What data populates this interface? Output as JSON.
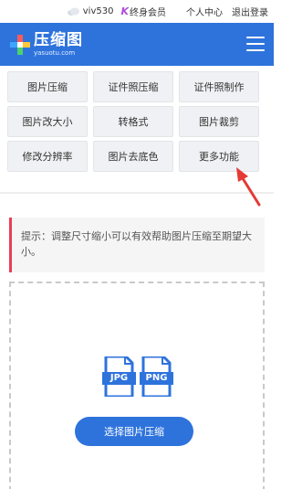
{
  "topbar": {
    "username": "viv530",
    "vip_label": "终身会员",
    "vip_mark": "K",
    "personal_center": "个人中心",
    "logout": "退出登录"
  },
  "header": {
    "logo_text": "压缩图",
    "logo_domain": "yasuotu.com",
    "brand_color": "#2e73dc"
  },
  "tools": [
    "图片压缩",
    "证件照压缩",
    "证件照制作",
    "图片改大小",
    "转格式",
    "图片裁剪",
    "修改分辨率",
    "图片去底色",
    "更多功能"
  ],
  "tip": {
    "text": "提示：调整尺寸缩小可以有效帮助图片压缩至期望大小。",
    "accent_color": "#ea3e55"
  },
  "upload": {
    "formats": [
      "JPG",
      "PNG"
    ],
    "button_label": "选择图片压缩"
  }
}
